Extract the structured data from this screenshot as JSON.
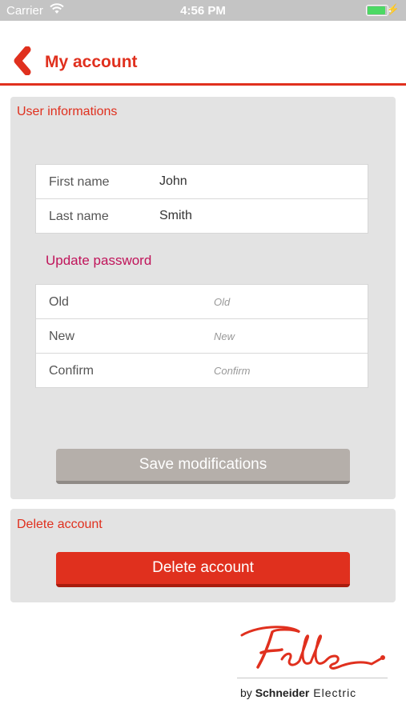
{
  "status_bar": {
    "carrier": "Carrier",
    "time": "4:56 PM",
    "battery_level": 1.0
  },
  "nav": {
    "title": "My account"
  },
  "user_info": {
    "section_title": "User informations",
    "fields": [
      {
        "label": "First name",
        "value": "John"
      },
      {
        "label": "Last name",
        "value": "Smith"
      }
    ],
    "password": {
      "title": "Update password",
      "fields": [
        {
          "label": "Old",
          "placeholder": "Old"
        },
        {
          "label": "New",
          "placeholder": "New"
        },
        {
          "label": "Confirm",
          "placeholder": "Confirm"
        }
      ]
    },
    "save_label": "Save modifications"
  },
  "delete": {
    "section_title": "Delete account",
    "button_label": "Delete account"
  },
  "branding": {
    "logo_text": "Feller",
    "tagline_prefix": "by ",
    "tagline_brand": "Schneider",
    "tagline_suffix": " Electric"
  },
  "colors": {
    "accent": "#e0301e",
    "password_title": "#c0145a",
    "save_button": "#b5afaa",
    "panel_bg": "#e3e3e3"
  }
}
